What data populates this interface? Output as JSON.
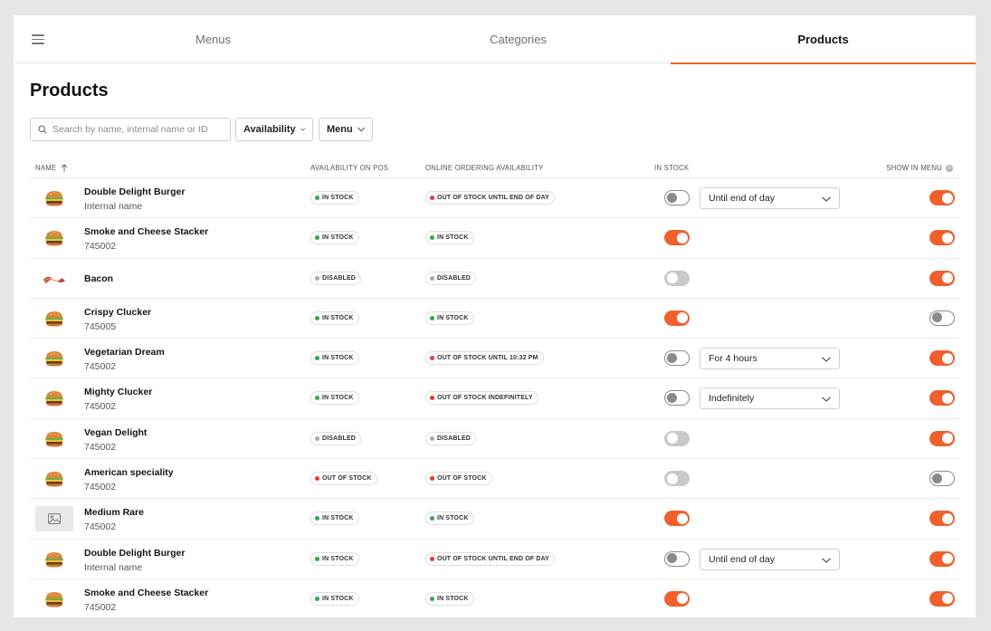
{
  "nav": {
    "tabs": [
      {
        "label": "Menus"
      },
      {
        "label": "Categories"
      },
      {
        "label": "Products"
      }
    ]
  },
  "page": {
    "title": "Products"
  },
  "toolbar": {
    "search_placeholder": "Search by name, internal name or ID",
    "availability_label": "Availability",
    "menu_label": "Menu"
  },
  "table": {
    "headers": {
      "name": "NAME",
      "pos": "AVAILABILITY ON POS",
      "online": "ONLINE ORDERING AVAILABILITY",
      "stock": "IN STOCK",
      "show": "SHOW IN MENU"
    },
    "rows": [
      {
        "name": "Double Delight Burger",
        "sub": "Internal name",
        "icon": "burger-icon",
        "pos": "IN STOCK",
        "online": "OUT OF STOCK UNTIL END OF DAY",
        "in_stock": "off",
        "duration": "Until end of day",
        "show": "on"
      },
      {
        "name": "Smoke and Cheese Stacker",
        "sub": "745002",
        "icon": "burger-icon",
        "pos": "IN STOCK",
        "online": "IN STOCK",
        "in_stock": "on",
        "duration": "",
        "show": "on"
      },
      {
        "name": "Bacon",
        "sub": "",
        "icon": "bacon-icon",
        "pos": "DISABLED",
        "online": "DISABLED",
        "in_stock": "disabled",
        "duration": "",
        "show": "on"
      },
      {
        "name": "Crispy Clucker",
        "sub": "745005",
        "icon": "burger-icon",
        "pos": "IN STOCK",
        "online": "IN STOCK",
        "in_stock": "on",
        "duration": "",
        "show": "off"
      },
      {
        "name": "Vegetarian Dream",
        "sub": "745002",
        "icon": "burger-icon",
        "pos": "IN STOCK",
        "online": "OUT OF STOCK UNTIL 10:32 PM",
        "in_stock": "off",
        "duration": "For 4 hours",
        "show": "on"
      },
      {
        "name": "Mighty Clucker",
        "sub": "745002",
        "icon": "burger-icon",
        "pos": "IN STOCK",
        "online": "OUT OF STOCK INDEFINITELY",
        "in_stock": "off",
        "duration": "Indefinitely",
        "show": "on"
      },
      {
        "name": "Vegan Delight",
        "sub": "745002",
        "icon": "burger-icon",
        "pos": "DISABLED",
        "online": "DISABLED",
        "in_stock": "disabled",
        "duration": "",
        "show": "on"
      },
      {
        "name": "American speciality",
        "sub": "745002",
        "icon": "burger-icon",
        "pos": "OUT OF STOCK",
        "online": "OUT OF STOCK",
        "in_stock": "disabled",
        "duration": "",
        "show": "off"
      },
      {
        "name": "Medium Rare",
        "sub": "745002",
        "icon": "image-placeholder-icon",
        "pos": "IN STOCK",
        "online": "IN STOCK",
        "in_stock": "on",
        "duration": "",
        "show": "on"
      },
      {
        "name": "Double Delight Burger",
        "sub": "Internal name",
        "icon": "burger-icon",
        "pos": "IN STOCK",
        "online": "OUT OF STOCK UNTIL END OF DAY",
        "in_stock": "off",
        "duration": "Until end of day",
        "show": "on"
      },
      {
        "name": "Smoke and Cheese Stacker",
        "sub": "745002",
        "icon": "burger-icon",
        "pos": "IN STOCK",
        "online": "IN STOCK",
        "in_stock": "on",
        "duration": "",
        "show": "on"
      }
    ]
  },
  "colors": {
    "accent": "#f0602d",
    "status_green": "#2fa84f",
    "status_red": "#e5383b",
    "status_gray": "#a8a8a8"
  }
}
